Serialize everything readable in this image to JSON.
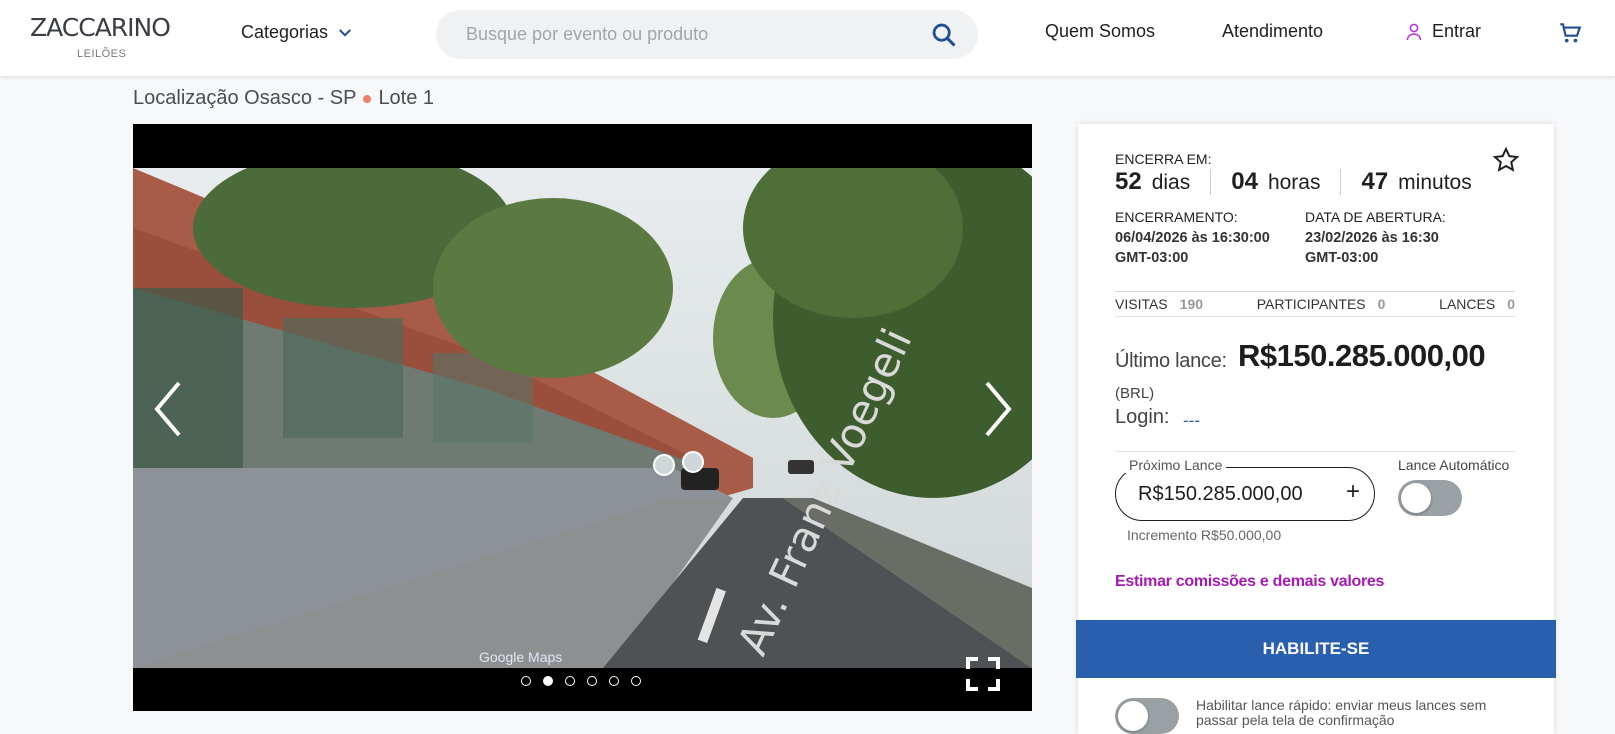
{
  "header": {
    "logo_text": "ZACCARINO",
    "logo_sub": "LEILÕES",
    "categories_label": "Categorias",
    "search_placeholder": "Busque por evento ou produto",
    "nav": [
      "Quem Somos",
      "Atendimento"
    ],
    "login_label": "Entrar",
    "icons": [
      "chevron-down-icon",
      "search-icon",
      "user-icon",
      "cart-icon"
    ],
    "accent_color": "#b33ad2"
  },
  "breadcrumb": {
    "location": "Localização Osasco - SP",
    "lot": "Lote 1"
  },
  "gallery": {
    "watermark": "Google Maps",
    "street_text": "Av. Franz Voegeli",
    "slide_count": 6,
    "active_slide": 2,
    "icons": [
      "chevron-left-icon",
      "chevron-right-icon",
      "fullscreen-icon"
    ]
  },
  "auction": {
    "ends_label": "ENCERRA EM:",
    "countdown": {
      "days": "52",
      "days_label": "dias",
      "hours": "04",
      "hours_label": "horas",
      "minutes": "47",
      "minutes_label": "minutos"
    },
    "closing_label": "ENCERRAMENTO:",
    "closing_date": "06/04/2026 às 16:30:00",
    "closing_tz": "GMT-03:00",
    "opening_label": "DATA DE ABERTURA:",
    "opening_date": "23/02/2026 às 16:30",
    "opening_tz": "GMT-03:00",
    "stats": {
      "visits_label": "VISITAS",
      "visits": "190",
      "participants_label": "PARTICIPANTES",
      "participants": "0",
      "bids_label": "LANCES",
      "bids": "0"
    },
    "last_bid_label": "Último lance:",
    "last_bid_value": "R$150.285.000,00",
    "currency": "(BRL)",
    "login_label": "Login:",
    "login_value": "---",
    "next_bid_label": "Próximo Lance",
    "next_bid_value": "R$150.285.000,00",
    "increment": "Incremento R$50.000,00",
    "auto_bid_label": "Lance Automático",
    "auto_bid_enabled": false,
    "estimate_link": "Estimar comissões e demais valores",
    "enable_button": "HABILITE-SE",
    "quick_bid_text": "Habilitar lance rápido: enviar meus lances sem passar pela tela de confirmação",
    "quick_bid_enabled": false,
    "colors": {
      "primary_button": "#2a5fae",
      "link": "#a51ab0"
    }
  }
}
